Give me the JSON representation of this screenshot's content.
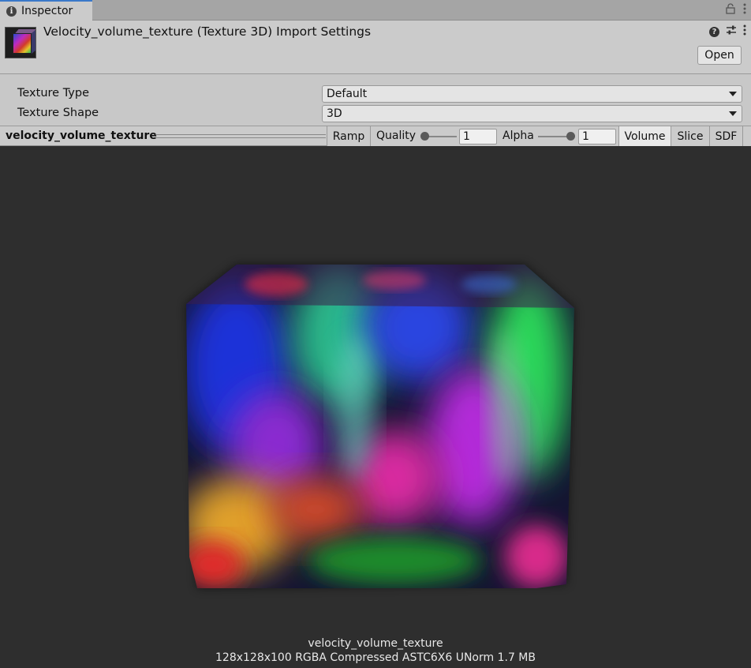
{
  "tab": {
    "label": "Inspector",
    "icon": "info-icon"
  },
  "tabbar_icons": [
    "lock-icon",
    "kebab-menu-icon"
  ],
  "header": {
    "title": "Velocity_volume_texture (Texture 3D) Import Settings",
    "open_label": "Open",
    "icons": [
      "help-icon",
      "preset-icon",
      "kebab-menu-icon"
    ]
  },
  "properties": [
    {
      "label": "Texture Type",
      "value": "Default"
    },
    {
      "label": "Texture Shape",
      "value": "3D"
    }
  ],
  "preview_toolbar": {
    "name": "velocity_volume_texture",
    "ramp_label": "Ramp",
    "quality_label": "Quality",
    "quality_value": "1",
    "quality_level": 0.0,
    "alpha_label": "Alpha",
    "alpha_value": "1",
    "alpha_level": 1.0,
    "modes": [
      "Volume",
      "Slice",
      "SDF"
    ],
    "active_mode": "Volume"
  },
  "preview": {
    "caption_name": "velocity_volume_texture",
    "caption_info": "128x128x100 RGBA Compressed ASTC6X6 UNorm 1.7 MB"
  },
  "colors": {
    "tab_accent": "#3a78c9",
    "viewport_bg": "#2e2e2e",
    "panel_bg": "#c8c8c8"
  }
}
